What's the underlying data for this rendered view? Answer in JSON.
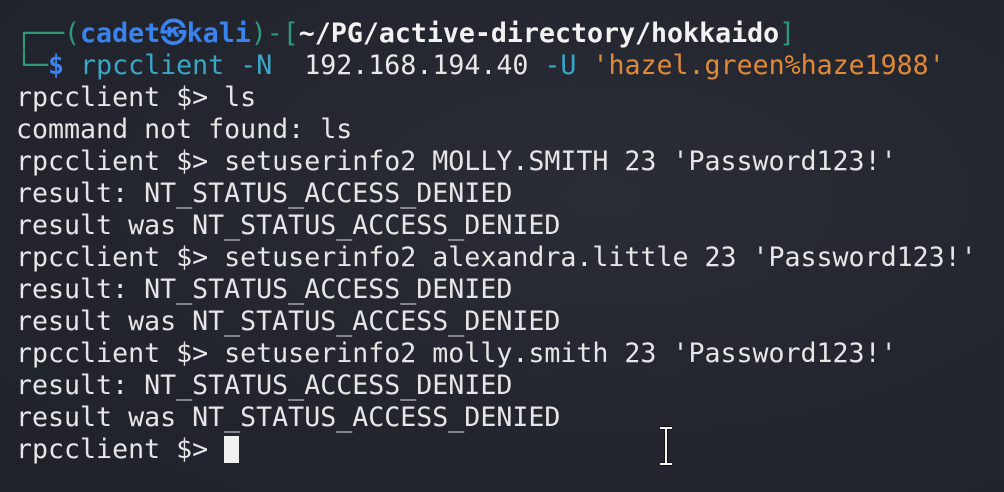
{
  "prompt": {
    "user": "cadet",
    "host": "kali",
    "path": "~/PG/active-directory/hokkaido",
    "command": "rpcclient",
    "args1": "-N",
    "ip": "192.168.194.40",
    "args2": "-U",
    "credential": "'hazel.green%haze1988'"
  },
  "lines": [
    "rpcclient $> ls",
    "command not found: ls",
    "rpcclient $> setuserinfo2 MOLLY.SMITH 23 'Password123!'",
    "result: NT_STATUS_ACCESS_DENIED",
    "result was NT_STATUS_ACCESS_DENIED",
    "rpcclient $> setuserinfo2 alexandra.little 23 'Password123!'",
    "result: NT_STATUS_ACCESS_DENIED",
    "result was NT_STATUS_ACCESS_DENIED",
    "rpcclient $> setuserinfo2 molly.smith 23 'Password123!'",
    "result: NT_STATUS_ACCESS_DENIED",
    "result was NT_STATUS_ACCESS_DENIED"
  ],
  "current_prompt": "rpcclient $> ",
  "colors": {
    "background": "#23262f",
    "prompt_frame": "#2f9a78",
    "user_host": "#3a82ee",
    "command": "#3aa6c8",
    "string": "#e0893a"
  }
}
